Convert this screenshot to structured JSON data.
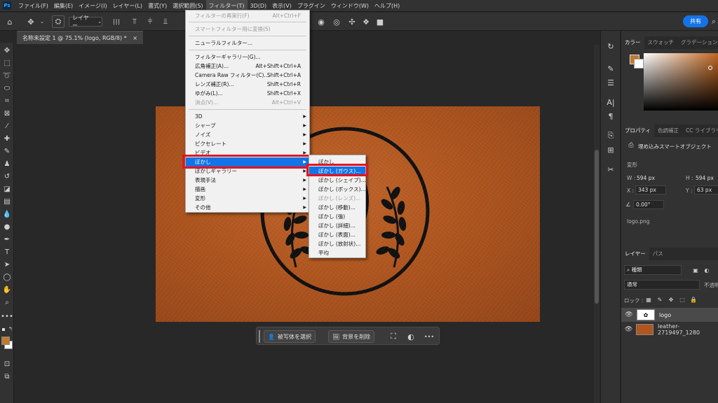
{
  "menubar": {
    "app_icon": "Ps",
    "items": [
      "ファイル(F)",
      "編集(E)",
      "イメージ(I)",
      "レイヤー(L)",
      "書式(Y)",
      "選択範囲(S)",
      "フィルター(T)",
      "3D(D)",
      "表示(V)",
      "プラグイン",
      "ウィンドウ(W)",
      "ヘルプ(H)"
    ]
  },
  "optionsbar": {
    "layer_select": "レイヤー",
    "share_label": "共有"
  },
  "document_tab": {
    "title": "名称未設定 1 @ 75.1% (logo, RGB/8) *",
    "close": "×"
  },
  "filter_menu": {
    "rows": [
      {
        "label": "フィルターの再実行(F)",
        "shortcut": "Alt+Ctrl+F",
        "disabled": true
      },
      {
        "label": "スマートフィルター用に変換(S)",
        "shortcut": "",
        "disabled": true
      },
      {
        "label": "ニューラルフィルター...",
        "shortcut": ""
      },
      {
        "label": "フィルターギャラリー(G)...",
        "shortcut": ""
      },
      {
        "label": "広角補正(A)...",
        "shortcut": "Alt+Shift+Ctrl+A"
      },
      {
        "label": "Camera Raw フィルター(C)...",
        "shortcut": "Shift+Ctrl+A"
      },
      {
        "label": "レンズ補正(R)...",
        "shortcut": "Shift+Ctrl+R"
      },
      {
        "label": "ゆがみ(L)...",
        "shortcut": "Shift+Ctrl+X"
      },
      {
        "label": "消点(V)...",
        "shortcut": "Alt+Ctrl+V",
        "disabled": true
      },
      {
        "label": "3D",
        "submenu": true
      },
      {
        "label": "シャープ",
        "submenu": true
      },
      {
        "label": "ノイズ",
        "submenu": true
      },
      {
        "label": "ピクセレート",
        "submenu": true
      },
      {
        "label": "ビデオ",
        "submenu": true
      },
      {
        "label": "ぼかし",
        "submenu": true,
        "highlighted": true
      },
      {
        "label": "ぼかしギャラリー",
        "submenu": true
      },
      {
        "label": "表現手法",
        "submenu": true
      },
      {
        "label": "描画",
        "submenu": true
      },
      {
        "label": "変形",
        "submenu": true
      },
      {
        "label": "その他",
        "submenu": true
      }
    ]
  },
  "blur_submenu": {
    "rows": [
      {
        "label": "ぼかし"
      },
      {
        "label": "ぼかし (ガウス)...",
        "highlighted": true
      },
      {
        "label": "ぼかし (シェイプ)..."
      },
      {
        "label": "ぼかし (ボックス)..."
      },
      {
        "label": "ぼかし (レンズ)...",
        "disabled": true
      },
      {
        "label": "ぼかし (移動)..."
      },
      {
        "label": "ぼかし (強)"
      },
      {
        "label": "ぼかし (詳細)..."
      },
      {
        "label": "ぼかし (表面)..."
      },
      {
        "label": "ぼかし (放射状)..."
      },
      {
        "label": "平均"
      }
    ]
  },
  "taskbar": {
    "select_subject": "被写体を選択",
    "remove_bg": "背景を削除",
    "more": "•••"
  },
  "color_panel": {
    "tabs": [
      "カラー",
      "スウォッチ",
      "グラデーション"
    ],
    "foreground": "#c07a2c"
  },
  "properties_panel": {
    "tabs": [
      "プロパティ",
      "色調補正",
      "CC ライブラリ"
    ],
    "object_type": "埋め込みスマートオブジェクト",
    "transform_label": "変形",
    "w_label": "W :",
    "w_value": "594 px",
    "h_label": "H :",
    "h_value": "594 px",
    "x_label": "X :",
    "x_value": "343 px",
    "y_label": "Y :",
    "y_value": "63 px",
    "angle_value": "0.00°",
    "file_name": "logo.png"
  },
  "layers_panel": {
    "tabs": [
      "レイヤー",
      "パス"
    ],
    "kind_label": "種類",
    "blend_mode": "通常",
    "opacity_label": "不透明",
    "lock_label": "ロック :",
    "layers": [
      {
        "name": "logo",
        "selected": true
      },
      {
        "name": "leather-2719497_1280",
        "selected": false
      }
    ]
  },
  "colors": {
    "accent": "#1473e6",
    "highlight_border": "#e5141e",
    "leather": "#b0561f"
  }
}
